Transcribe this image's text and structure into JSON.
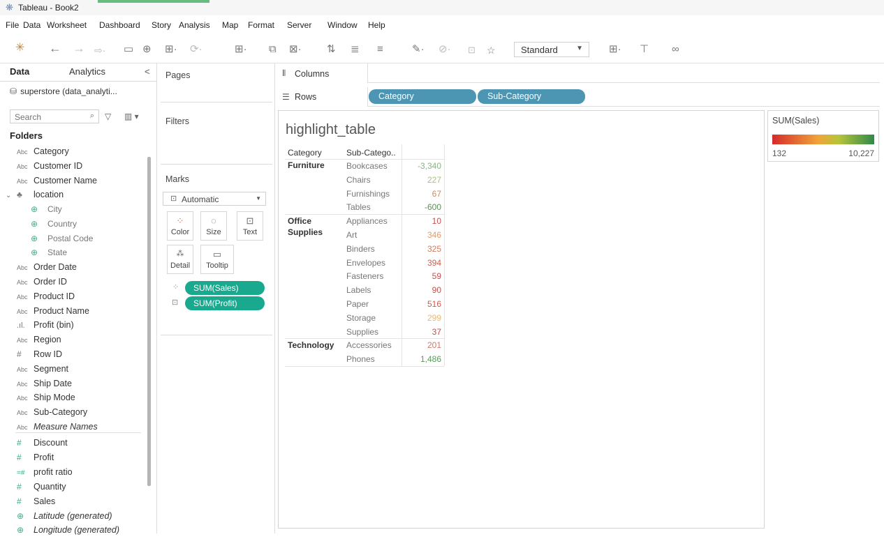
{
  "window": {
    "title": "Tableau - Book2"
  },
  "menu": [
    "File",
    "Data",
    "Worksheet",
    "Dashboard",
    "Story",
    "Analysis",
    "Map",
    "Format",
    "Server",
    "Window",
    "Help"
  ],
  "toolbar": {
    "fit_selector": "Standard"
  },
  "left_pane": {
    "tabs": [
      "Data",
      "Analytics"
    ],
    "datasource": "superstore (data_analyti...",
    "search_placeholder": "Search",
    "folders_heading": "Folders",
    "fields": [
      {
        "name": "Category",
        "icon": "Abc"
      },
      {
        "name": "Customer ID",
        "icon": "Abc"
      },
      {
        "name": "Customer Name",
        "icon": "Abc"
      },
      {
        "name": "location",
        "icon": "hierarchy"
      },
      {
        "name": "City",
        "icon": "globe"
      },
      {
        "name": "Country",
        "icon": "globe"
      },
      {
        "name": "Postal Code",
        "icon": "globe"
      },
      {
        "name": "State",
        "icon": "globe"
      },
      {
        "name": "Order Date",
        "icon": "Abc"
      },
      {
        "name": "Order ID",
        "icon": "Abc"
      },
      {
        "name": "Product ID",
        "icon": "Abc"
      },
      {
        "name": "Product Name",
        "icon": "Abc"
      },
      {
        "name": "Profit (bin)",
        "icon": "bin"
      },
      {
        "name": "Region",
        "icon": "Abc"
      },
      {
        "name": "Row ID",
        "icon": "#"
      },
      {
        "name": "Segment",
        "icon": "Abc"
      },
      {
        "name": "Ship Date",
        "icon": "Abc"
      },
      {
        "name": "Ship Mode",
        "icon": "Abc"
      },
      {
        "name": "Sub-Category",
        "icon": "Abc"
      },
      {
        "name": "Measure Names",
        "icon": "Abc"
      },
      {
        "name": "Discount",
        "icon": "#"
      },
      {
        "name": "Profit",
        "icon": "#"
      },
      {
        "name": "profit ratio",
        "icon": "=#"
      },
      {
        "name": "Quantity",
        "icon": "#"
      },
      {
        "name": "Sales",
        "icon": "#"
      },
      {
        "name": "Latitude (generated)",
        "icon": "globe"
      },
      {
        "name": "Longitude (generated)",
        "icon": "globe"
      }
    ]
  },
  "shelves": {
    "pages": "Pages",
    "filters": "Filters",
    "marks": "Marks",
    "mark_type": "Automatic",
    "mark_buttons": [
      "Color",
      "Size",
      "Text",
      "Detail",
      "Tooltip"
    ],
    "mark_pills": [
      "SUM(Sales)",
      "SUM(Profit)"
    ],
    "columns_label": "Columns",
    "rows_label": "Rows",
    "row_pills": [
      "Category",
      "Sub-Category"
    ]
  },
  "view": {
    "title": "highlight_table",
    "headers": [
      "Category",
      "Sub-Catego.."
    ],
    "groups": [
      {
        "category": "Furniture",
        "rows": [
          {
            "sub": "Bookcases",
            "value": "-3,340",
            "color": "#7dbb7d"
          },
          {
            "sub": "Chairs",
            "value": "227",
            "color": "#a9c37d"
          },
          {
            "sub": "Furnishings",
            "value": "67",
            "color": "#d08a5a"
          },
          {
            "sub": "Tables",
            "value": "-600",
            "color": "#5a8f55"
          }
        ]
      },
      {
        "category": "Office Supplies",
        "rows": [
          {
            "sub": "Appliances",
            "value": "10",
            "color": "#c0504d"
          },
          {
            "sub": "Art",
            "value": "346",
            "color": "#e39a6a"
          },
          {
            "sub": "Binders",
            "value": "325",
            "color": "#d9795c"
          },
          {
            "sub": "Envelopes",
            "value": "394",
            "color": "#cf5c4e"
          },
          {
            "sub": "Fasteners",
            "value": "59",
            "color": "#c0504d"
          },
          {
            "sub": "Labels",
            "value": "90",
            "color": "#c0504d"
          },
          {
            "sub": "Paper",
            "value": "516",
            "color": "#d0574f"
          },
          {
            "sub": "Storage",
            "value": "299",
            "color": "#e8b87a"
          },
          {
            "sub": "Supplies",
            "value": "37",
            "color": "#c0504d"
          }
        ]
      },
      {
        "category": "Technology",
        "rows": [
          {
            "sub": "Accessories",
            "value": "201",
            "color": "#d07a6a"
          },
          {
            "sub": "Phones",
            "value": "1,486",
            "color": "#5b9a5b"
          }
        ]
      }
    ]
  },
  "legend": {
    "title": "SUM(Sales)",
    "min": "132",
    "max": "10,227"
  }
}
